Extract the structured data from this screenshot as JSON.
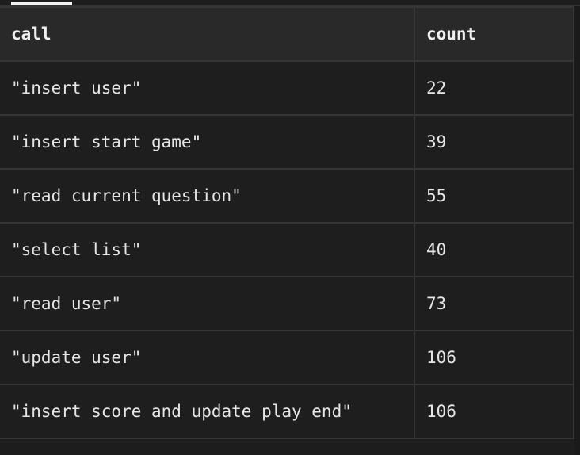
{
  "table": {
    "columns": [
      "call",
      "count"
    ],
    "rows": [
      {
        "call": "\"insert user\"",
        "count": "22"
      },
      {
        "call": "\"insert start game\"",
        "count": "39"
      },
      {
        "call": "\"read current question\"",
        "count": "55"
      },
      {
        "call": "\"select list\"",
        "count": "40"
      },
      {
        "call": "\"read user\"",
        "count": "73"
      },
      {
        "call": "\"update user\"",
        "count": "106"
      },
      {
        "call": "\"insert score and update play end\"",
        "count": "106"
      }
    ]
  }
}
